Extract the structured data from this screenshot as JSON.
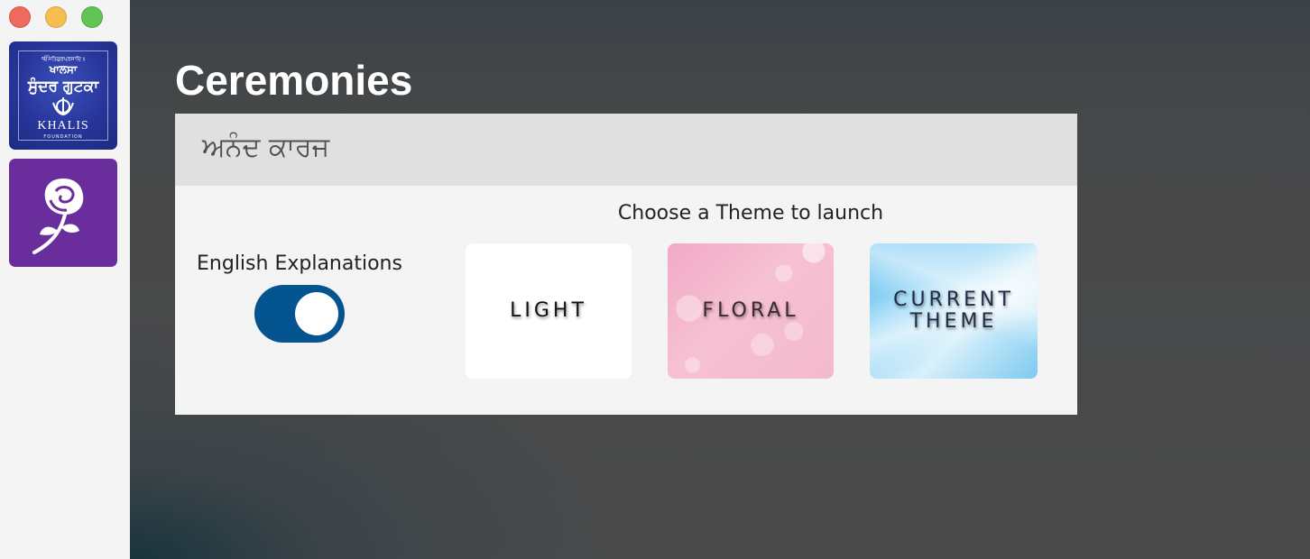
{
  "window": {
    "controls": [
      "close",
      "minimize",
      "maximize"
    ]
  },
  "sidebar": {
    "apps": [
      {
        "name": "Khalsa Sundar Gutka",
        "top_text": "ੴਸਤਿਗੁਰਪ੍ਰਸਾਦਿ॥",
        "line1": "ਖਾਲਸਾ",
        "line2": "ਸੁੰਦਰ ਗੁਟਕਾ",
        "brand": "KHALIS",
        "sub": "FOUNDATION",
        "icon": "khanda-icon",
        "color": "#27359a"
      },
      {
        "name": "Rose",
        "icon": "rose-icon",
        "color": "#6a2d9c"
      }
    ]
  },
  "main": {
    "title": "Ceremonies",
    "card": {
      "header": "ਅਨੰਦ ਕਾਰਜ",
      "toggle": {
        "label": "English Explanations",
        "on": true,
        "color": "#03548f"
      },
      "themes_heading": "Choose a Theme to launch",
      "themes": [
        {
          "label": "LIGHT"
        },
        {
          "label": "FLORAL"
        },
        {
          "label_line1": "CURRENT",
          "label_line2": "THEME"
        }
      ]
    }
  }
}
